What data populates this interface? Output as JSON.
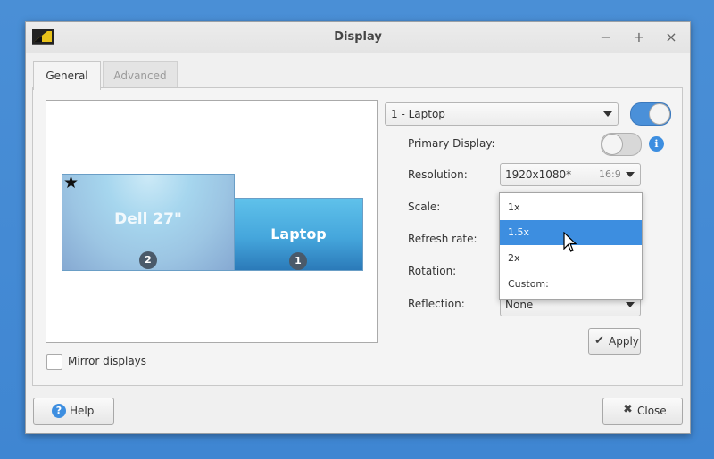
{
  "window": {
    "title": "Display"
  },
  "tabs": [
    {
      "label": "General",
      "active": true
    },
    {
      "label": "Advanced",
      "active": false
    }
  ],
  "monitors": [
    {
      "name": "Dell 27\"",
      "number": "2",
      "primary": true
    },
    {
      "name": "Laptop",
      "number": "1",
      "primary": false
    }
  ],
  "mirror": {
    "label": "Mirror displays",
    "checked": false
  },
  "display_select": {
    "value": "1 - Laptop",
    "enabled": true
  },
  "primary_display": {
    "label": "Primary Display:",
    "enabled": false
  },
  "resolution": {
    "label": "Resolution:",
    "value": "1920x1080*",
    "aspect": "16:9"
  },
  "scale": {
    "label": "Scale:"
  },
  "refresh_rate": {
    "label": "Refresh rate:"
  },
  "rotation": {
    "label": "Rotation:"
  },
  "reflection": {
    "label": "Reflection:",
    "value": "None"
  },
  "scale_options": [
    {
      "label": "1x",
      "selected": false
    },
    {
      "label": "1.5x",
      "selected": true
    },
    {
      "label": "2x",
      "selected": false
    },
    {
      "label": "Custom:",
      "selected": false
    }
  ],
  "buttons": {
    "apply": "Apply",
    "help": "Help",
    "close": "Close"
  },
  "colors": {
    "accent": "#3d8ee0",
    "desktop": "#4a8fd6"
  }
}
